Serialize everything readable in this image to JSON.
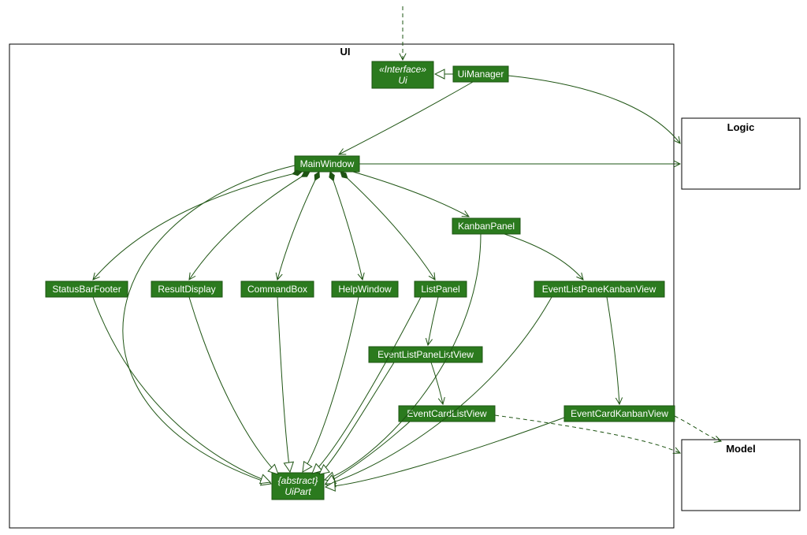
{
  "diagram_type": "uml_class_diagram",
  "packages": {
    "ui": {
      "title": "UI"
    },
    "logic": {
      "title": "Logic"
    },
    "model": {
      "title": "Model"
    }
  },
  "nodes": {
    "ui_interface": {
      "stereotype": "«Interface»",
      "name": "Ui"
    },
    "uimanager": {
      "name": "UiManager"
    },
    "mainwindow": {
      "name": "MainWindow"
    },
    "kanbanpanel": {
      "name": "KanbanPanel"
    },
    "statusbarfooter": {
      "name": "StatusBarFooter"
    },
    "resultdisplay": {
      "name": "ResultDisplay"
    },
    "commandbox": {
      "name": "CommandBox"
    },
    "helpwindow": {
      "name": "HelpWindow"
    },
    "listpanel": {
      "name": "ListPanel"
    },
    "elp_kanban": {
      "name": "EventListPaneKanbanView"
    },
    "elp_list": {
      "name": "EventListPaneListView"
    },
    "ec_list": {
      "name": "EventCardListView"
    },
    "ec_kanban": {
      "name": "EventCardKanbanView"
    },
    "uipart": {
      "stereotype": "{abstract}",
      "name": "UiPart"
    }
  },
  "colors": {
    "node_fill": "#2b7a1e",
    "node_stroke": "#1e5413",
    "edge": "#1e5413"
  },
  "edges": [
    {
      "from": "external_top",
      "to": "ui_interface",
      "style": "dashed",
      "arrow": "open"
    },
    {
      "from": "uimanager",
      "to": "ui_interface",
      "style": "solid",
      "arrow": "hollow_triangle",
      "relation": "realization"
    },
    {
      "from": "uimanager",
      "to": "mainwindow",
      "style": "solid",
      "arrow": "open"
    },
    {
      "from": "uimanager",
      "to": "logic_pkg",
      "style": "solid",
      "arrow": "open"
    },
    {
      "from": "mainwindow",
      "to": "logic_pkg",
      "style": "solid",
      "arrow": "open"
    },
    {
      "from": "mainwindow",
      "to": "statusbarfooter",
      "style": "solid",
      "arrow": "open",
      "aggregation": "composition"
    },
    {
      "from": "mainwindow",
      "to": "resultdisplay",
      "style": "solid",
      "arrow": "open",
      "aggregation": "composition"
    },
    {
      "from": "mainwindow",
      "to": "commandbox",
      "style": "solid",
      "arrow": "open",
      "aggregation": "composition"
    },
    {
      "from": "mainwindow",
      "to": "helpwindow",
      "style": "solid",
      "arrow": "open",
      "aggregation": "composition"
    },
    {
      "from": "mainwindow",
      "to": "listpanel",
      "style": "solid",
      "arrow": "open",
      "aggregation": "composition"
    },
    {
      "from": "mainwindow",
      "to": "kanbanpanel",
      "style": "solid",
      "arrow": "open"
    },
    {
      "from": "kanbanpanel",
      "to": "elp_kanban",
      "style": "solid",
      "arrow": "open"
    },
    {
      "from": "listpanel",
      "to": "elp_list",
      "style": "solid",
      "arrow": "open"
    },
    {
      "from": "elp_list",
      "to": "ec_list",
      "style": "solid",
      "arrow": "open"
    },
    {
      "from": "elp_kanban",
      "to": "ec_kanban",
      "style": "solid",
      "arrow": "open"
    },
    {
      "from": "statusbarfooter",
      "to": "uipart",
      "style": "solid",
      "arrow": "hollow_triangle",
      "relation": "generalization"
    },
    {
      "from": "resultdisplay",
      "to": "uipart",
      "style": "solid",
      "arrow": "hollow_triangle",
      "relation": "generalization"
    },
    {
      "from": "commandbox",
      "to": "uipart",
      "style": "solid",
      "arrow": "hollow_triangle",
      "relation": "generalization"
    },
    {
      "from": "helpwindow",
      "to": "uipart",
      "style": "solid",
      "arrow": "hollow_triangle",
      "relation": "generalization"
    },
    {
      "from": "listpanel",
      "to": "uipart",
      "style": "solid",
      "arrow": "hollow_triangle",
      "relation": "generalization"
    },
    {
      "from": "kanbanpanel",
      "to": "uipart",
      "style": "solid",
      "arrow": "hollow_triangle",
      "relation": "generalization"
    },
    {
      "from": "mainwindow",
      "to": "uipart",
      "style": "solid",
      "arrow": "hollow_triangle",
      "relation": "generalization"
    },
    {
      "from": "elp_kanban",
      "to": "uipart",
      "style": "solid",
      "arrow": "hollow_triangle",
      "relation": "generalization"
    },
    {
      "from": "elp_list",
      "to": "uipart",
      "style": "solid",
      "arrow": "hollow_triangle",
      "relation": "generalization"
    },
    {
      "from": "ec_list",
      "to": "uipart",
      "style": "solid",
      "arrow": "hollow_triangle",
      "relation": "generalization"
    },
    {
      "from": "ec_kanban",
      "to": "uipart",
      "style": "solid",
      "arrow": "hollow_triangle",
      "relation": "generalization"
    },
    {
      "from": "ec_kanban",
      "to": "model_pkg",
      "style": "dashed",
      "arrow": "open"
    },
    {
      "from": "ec_list",
      "to": "model_pkg",
      "style": "dashed",
      "arrow": "open"
    }
  ]
}
